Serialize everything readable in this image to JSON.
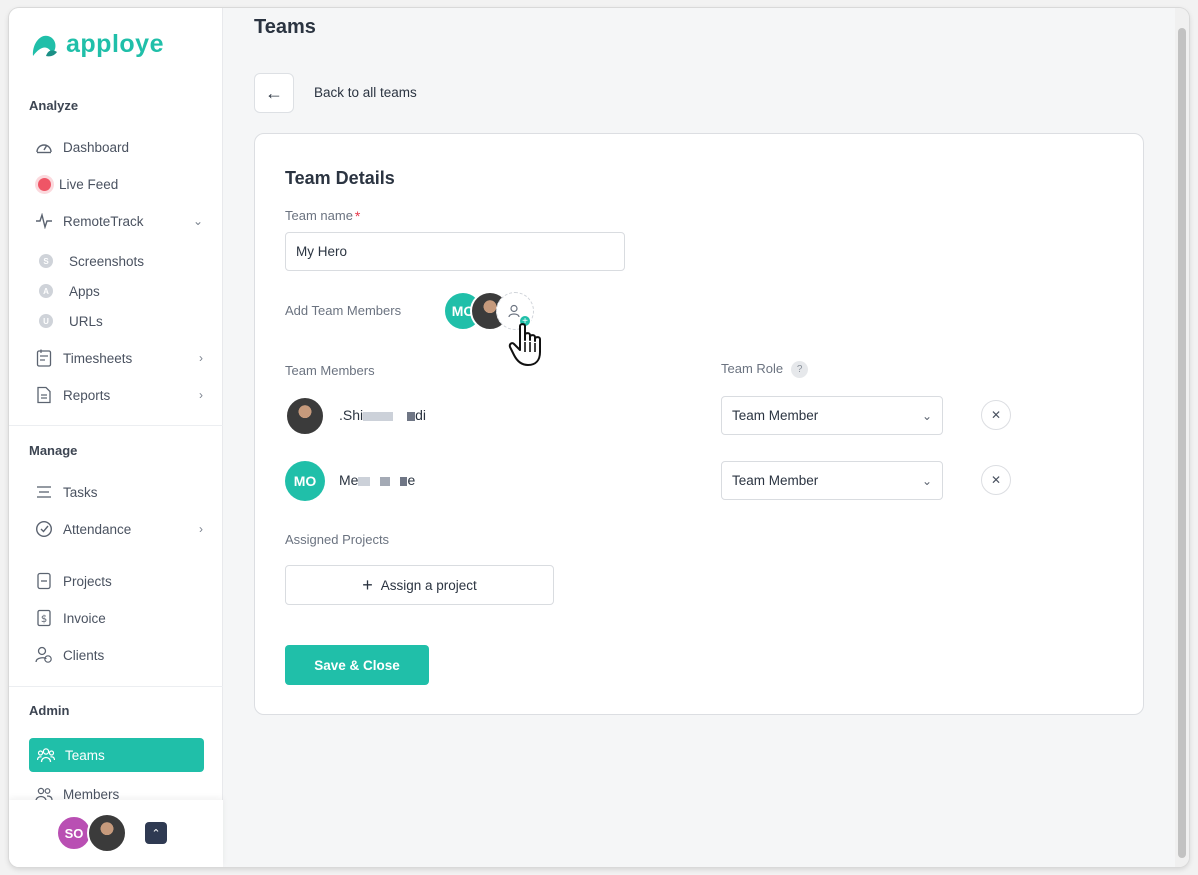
{
  "app": {
    "brand": "apploye",
    "accent_color": "#20bfa9"
  },
  "sidebar": {
    "sections": {
      "analyze": "Analyze",
      "manage": "Manage",
      "admin": "Admin"
    },
    "items": {
      "dashboard": "Dashboard",
      "live_feed": "Live Feed",
      "remotetrack": "RemoteTrack",
      "screenshots": "Screenshots",
      "screenshots_badge": "S",
      "apps": "Apps",
      "apps_badge": "A",
      "urls": "URLs",
      "urls_badge": "U",
      "timesheets": "Timesheets",
      "reports": "Reports",
      "tasks": "Tasks",
      "attendance": "Attendance",
      "projects": "Projects",
      "invoice": "Invoice",
      "clients": "Clients",
      "teams": "Teams",
      "members": "Members"
    },
    "footer": {
      "user_initials": "SO"
    }
  },
  "page": {
    "title": "Teams",
    "back_label": "Back to all teams"
  },
  "card": {
    "title": "Team Details",
    "team_name_label": "Team name",
    "required_mark": "*",
    "team_name_value": "My Hero",
    "add_members_label": "Add Team Members",
    "add_members_avatar_initials": "MO",
    "team_members_label": "Team Members",
    "team_role_label": "Team Role",
    "help_mark": "?",
    "members": [
      {
        "name_start": ".Shi",
        "name_end": "di",
        "role": "Team Member"
      },
      {
        "initials": "MO",
        "name_start": "Me",
        "name_end": "e",
        "role": "Team Member"
      }
    ],
    "assigned_projects_label": "Assigned Projects",
    "assign_button": "Assign a project",
    "save_button": "Save & Close"
  }
}
